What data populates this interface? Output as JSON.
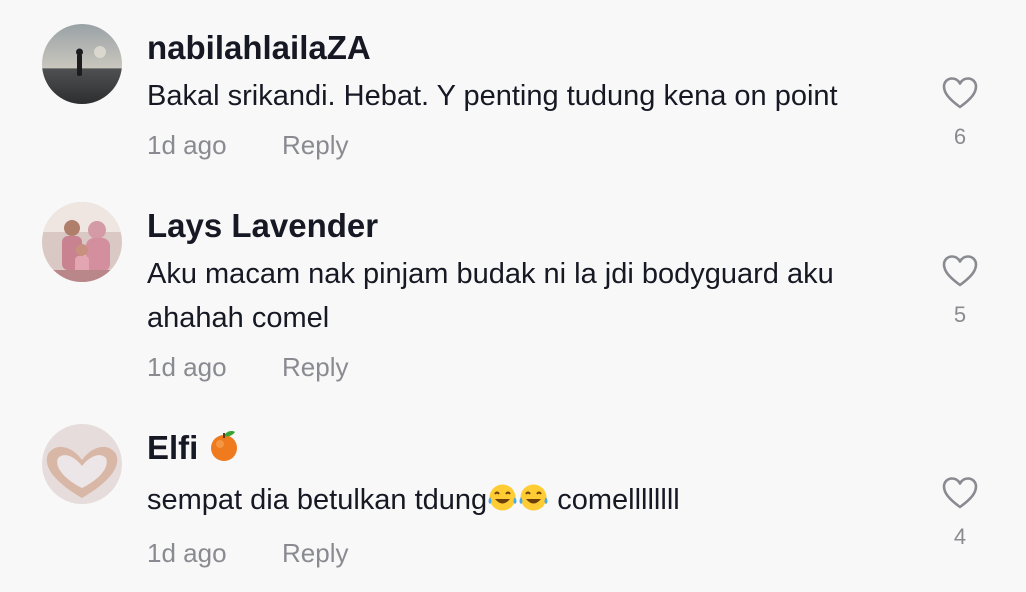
{
  "comments": [
    {
      "username": "nabilahlailaZA",
      "text": "Bakal srikandi. Hebat. Y penting tudung kena on point",
      "time": "1d ago",
      "reply_label": "Reply",
      "likes": "6"
    },
    {
      "username": "Lays Lavender",
      "text_line1": "Aku macam nak pinjam budak ni la jdi bodyguard aku",
      "text_line2": "ahahah comel",
      "time": "1d ago",
      "reply_label": "Reply",
      "likes": "5"
    },
    {
      "username": "Elfi",
      "username_emoji": "tangerine-emoji",
      "text_before": "sempat dia betulkan tdung",
      "text_emoji": "tears-of-joy-emoji",
      "text_after": " comellllllll",
      "time": "1d ago",
      "reply_label": "Reply",
      "likes": "4"
    }
  ],
  "colors": {
    "background": "#f8f8f8",
    "primary_text": "#161823",
    "secondary_text": "#8a8b91"
  }
}
